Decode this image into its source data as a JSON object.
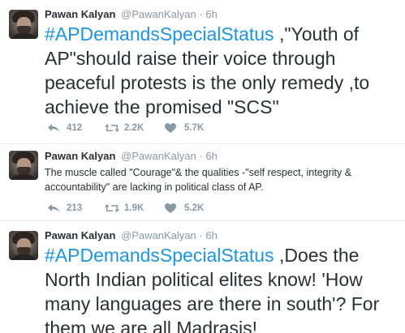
{
  "tweets": [
    {
      "author": "Pawan Kalyan",
      "handle": "@PawanKalyan",
      "separator": "·",
      "time": "6h",
      "hashtag": "#APDemandsSpecialStatus",
      "body": " ,\"Youth of AP\"should raise their voice  through peaceful protests is the only remedy ,to achieve  the promised \"SCS\"",
      "replies": "412",
      "retweets": "2.2K",
      "likes": "5.7K"
    },
    {
      "author": "Pawan Kalyan",
      "handle": "@PawanKalyan",
      "separator": "·",
      "time": "6h",
      "hashtag": "",
      "body": "The muscle called \"Courage\"& the qualities -\"self respect, integrity & accountability\" are lacking in political class of AP.",
      "replies": "213",
      "retweets": "1.9K",
      "likes": "5.2K"
    },
    {
      "author": "Pawan Kalyan",
      "handle": "@PawanKalyan",
      "separator": "·",
      "time": "6h",
      "hashtag": "#APDemandsSpecialStatus",
      "body": " ,Does the North Indian political elites know! 'How many languages are there in south'? For them we are all Madrasis!"
    }
  ],
  "colors": {
    "hashtag": "#1b95e0",
    "text": "#292f33",
    "meta": "#8899a6",
    "divider": "#e6ecf0"
  },
  "icons": [
    "avatar",
    "reply-icon",
    "retweet-icon",
    "like-icon"
  ]
}
